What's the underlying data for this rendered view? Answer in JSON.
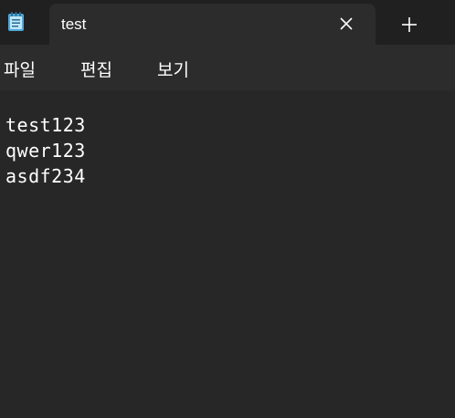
{
  "app": {
    "icon": "notepad-icon"
  },
  "tab": {
    "title": "test",
    "close_icon": "close-icon"
  },
  "new_tab_icon": "plus-icon",
  "menu": {
    "items": [
      {
        "label": "파일"
      },
      {
        "label": "편집"
      },
      {
        "label": "보기"
      }
    ]
  },
  "editor": {
    "lines": [
      "test123",
      "qwer123",
      "asdf234"
    ]
  },
  "colors": {
    "titlebar_bg": "#202020",
    "tab_bg": "#2c2c2c",
    "editor_bg": "#272727",
    "text": "#ffffff",
    "icon_accent": "#4fa7d8"
  }
}
